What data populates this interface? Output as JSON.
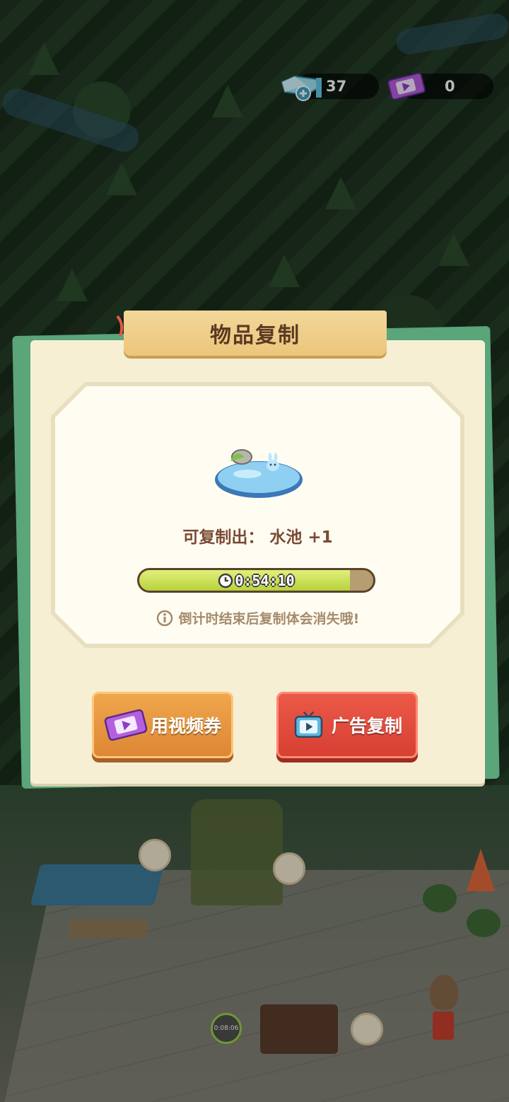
{
  "hud": {
    "gems": "37",
    "video_tickets": "0"
  },
  "dialog": {
    "title": "物品复制",
    "result_label": "可复制出：",
    "result_item": "水池",
    "result_count": "+1",
    "timer": "0:54:10",
    "timer_progress": 0.9,
    "hint": "倒计时结束后复制体会消失哦!",
    "btn_video": "用视频券",
    "btn_ad": "广告复制"
  },
  "scene": {
    "chip_timer": "0:08:06"
  },
  "icons": [
    "gem-plus-icon",
    "video-ticket-icon",
    "pond-icon",
    "clock-icon",
    "info-icon",
    "tv-icon"
  ],
  "colors": {
    "dialog_bg": "#f6efd4",
    "title_tab": "#ecc57a",
    "progress_fill": "#b6d33c",
    "btn_video": "#dc8633",
    "btn_ad": "#d63f32"
  }
}
